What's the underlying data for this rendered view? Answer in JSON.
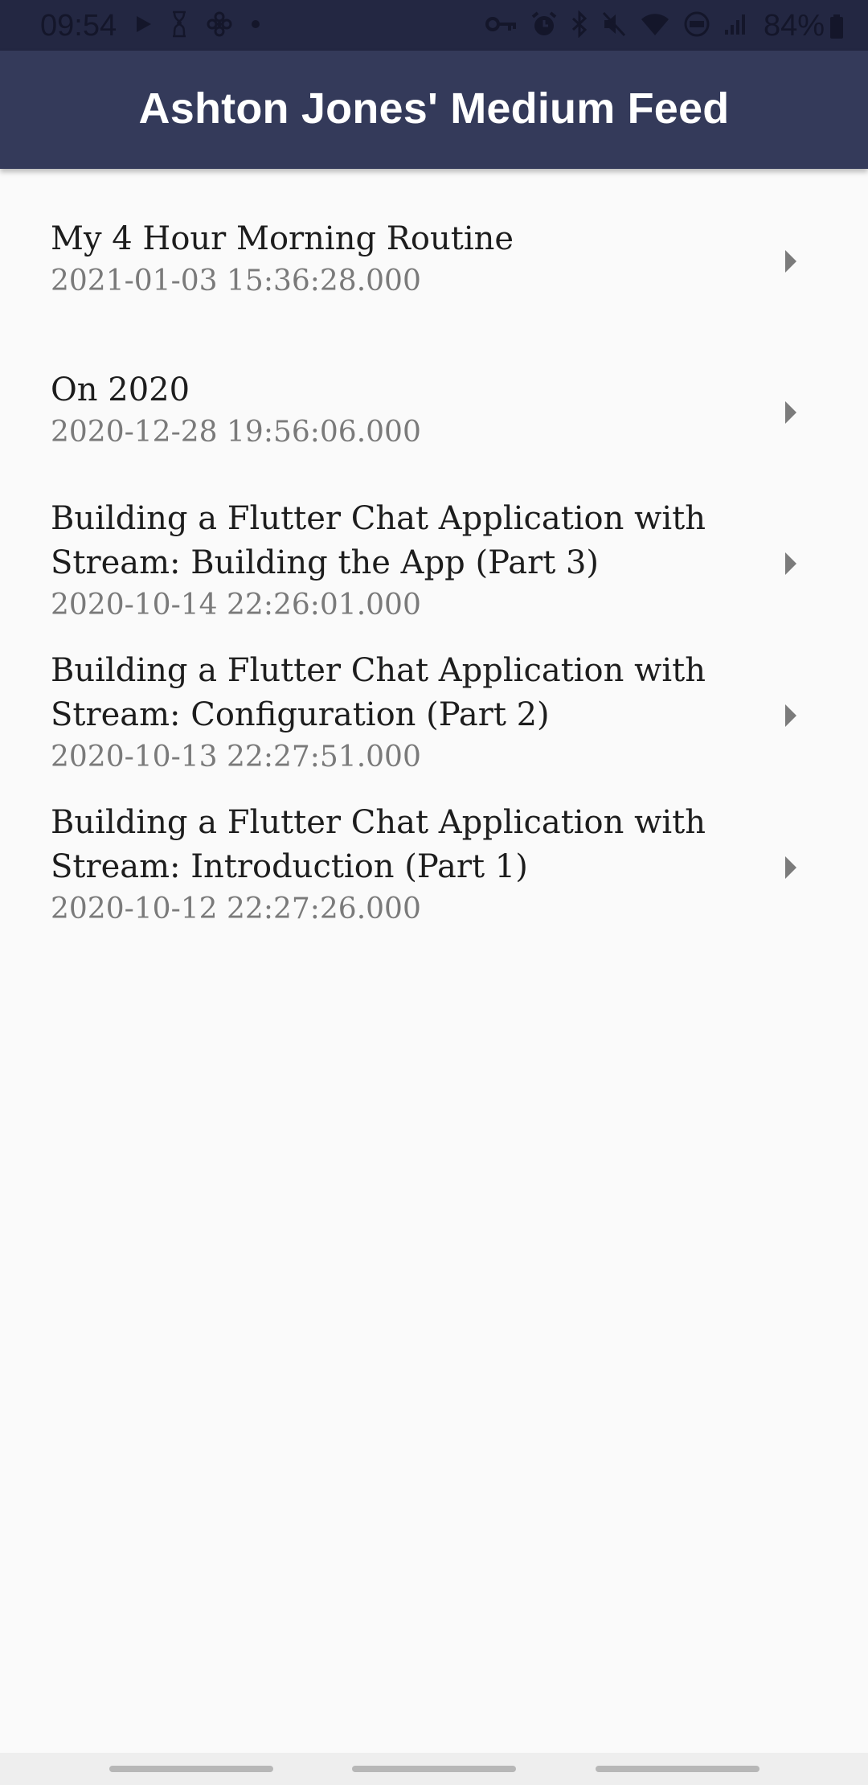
{
  "status_bar": {
    "time": "09:54",
    "battery": "84%",
    "left_icons": [
      "play-icon",
      "hourglass-icon",
      "fan-icon",
      "dot-icon"
    ],
    "right_icons": [
      "key-icon",
      "alarm-icon",
      "bluetooth-icon",
      "mute-icon",
      "wifi-icon",
      "volte-icon",
      "signal-icon",
      "battery-icon"
    ]
  },
  "app_bar": {
    "title": "Ashton Jones' Medium Feed"
  },
  "feed": {
    "items": [
      {
        "title": "My 4 Hour Morning Routine",
        "date": "2021-01-03 15:36:28.000"
      },
      {
        "title": "On 2020",
        "date": "2020-12-28 19:56:06.000"
      },
      {
        "title_line1": "Building a Flutter Chat Application with",
        "title_line2": "Stream: Building the App (Part 3)",
        "date": "2020-10-14 22:26:01.000"
      },
      {
        "title_line1": "Building a Flutter Chat Application with",
        "title_line2": "Stream: Configuration (Part 2)",
        "date": "2020-10-13 22:27:51.000"
      },
      {
        "title_line1": "Building a Flutter Chat Application with",
        "title_line2": "Stream: Introduction (Part 1)",
        "date": "2020-10-12 22:27:26.000"
      }
    ],
    "chevron_icon": "chevron-right-icon"
  },
  "colors": {
    "status_bar": "#232742",
    "app_bar": "#343a5a",
    "background": "#fafafa",
    "title_text": "#1d1d1d",
    "date_text": "#7a7a7a",
    "chevron": "#7b7b7b",
    "nav_bar": "#eeeeee"
  }
}
